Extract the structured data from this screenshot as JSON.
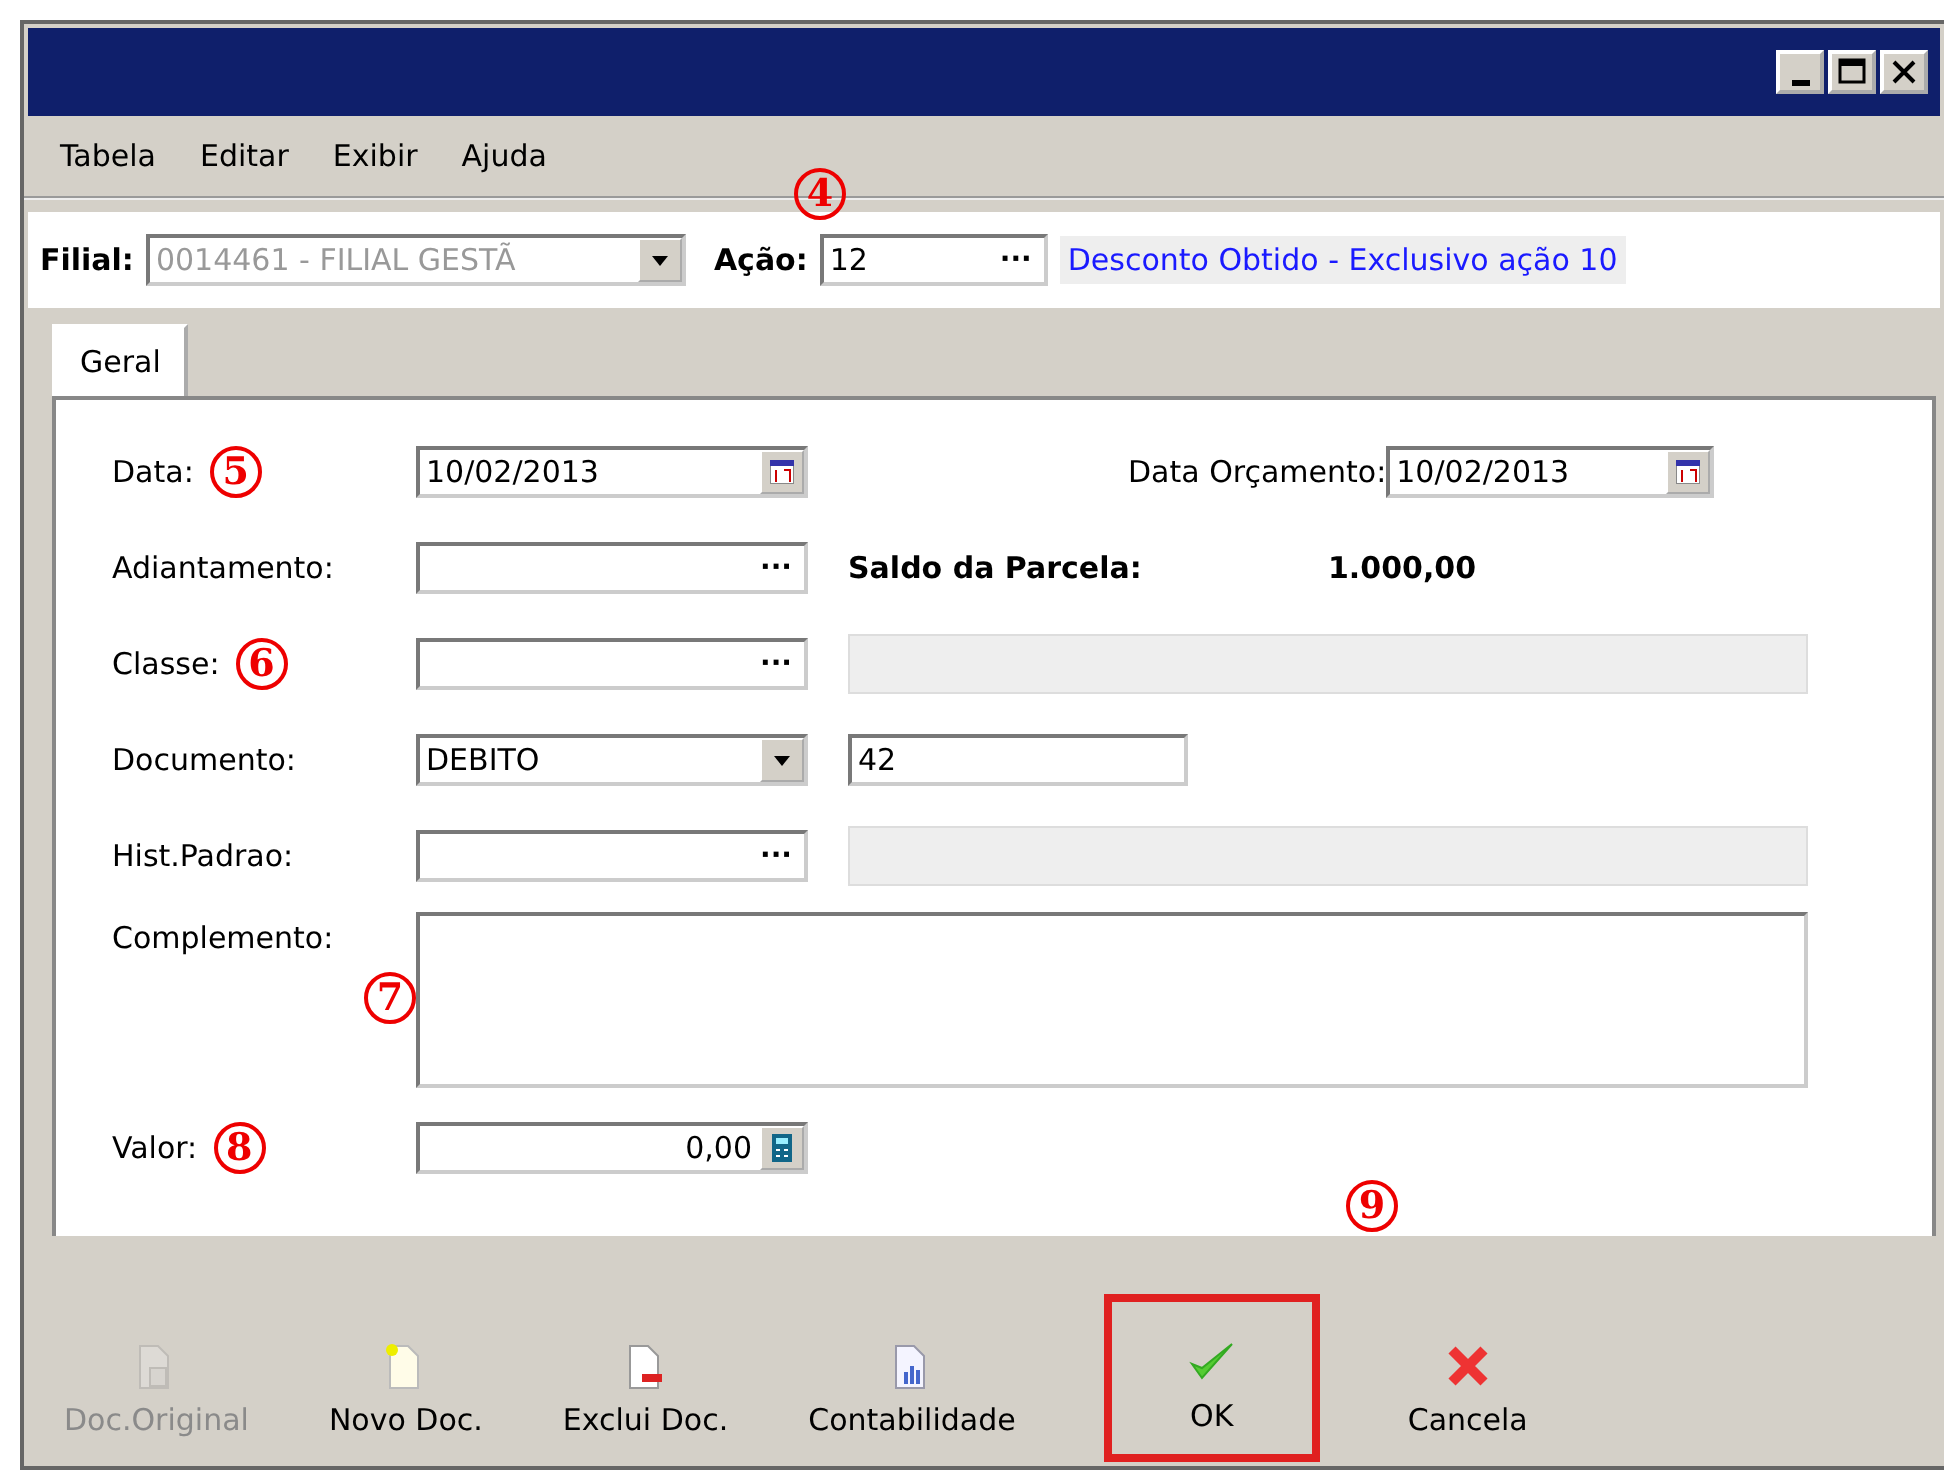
{
  "window": {
    "controls": [
      {
        "kind": "minimize"
      },
      {
        "kind": "maximize"
      },
      {
        "kind": "close"
      }
    ]
  },
  "menu": [
    {
      "label": "Tabela"
    },
    {
      "label": "Editar"
    },
    {
      "label": "Exibir"
    },
    {
      "label": "Ajuda"
    }
  ],
  "header": {
    "annotation": "4",
    "filial": {
      "label": "Filial:",
      "value": "0014461 - FILIAL GESTÃ",
      "disabled": true
    },
    "acao": {
      "label": "Ação:",
      "value": "12",
      "button": "···",
      "description": "Desconto Obtido - Exclusivo ação 10"
    }
  },
  "tabs": [
    {
      "label": "Geral",
      "selected": true
    }
  ],
  "form": {
    "data": {
      "label": "Data:",
      "value": "10/02/2013",
      "annotation": "5"
    },
    "data_orcamento": {
      "label": "Data Orçamento:",
      "value": "10/02/2013"
    },
    "adiantamento": {
      "label": "Adiantamento:",
      "button": "···"
    },
    "saldo_parcela": {
      "label": "Saldo da Parcela:",
      "value": "1.000,00"
    },
    "classe": {
      "label": "Classe:",
      "button": "···",
      "annotation": "6"
    },
    "documento": {
      "label": "Documento:",
      "value": "DEBITO",
      "number": "42"
    },
    "hist_padrao": {
      "label": "Hist.Padrao:",
      "button": "···"
    },
    "complemento": {
      "label": "Complemento:",
      "annotation": "7"
    },
    "valor": {
      "label": "Valor:",
      "value": "0,00",
      "annotation": "8"
    }
  },
  "toolbar": {
    "annotation": "9",
    "buttons": [
      {
        "kind": "doc-original",
        "label": "Doc.Original",
        "disabled": true,
        "highlighted": false
      },
      {
        "kind": "new-doc",
        "label": "Novo Doc.",
        "disabled": false,
        "highlighted": false
      },
      {
        "kind": "delete-doc",
        "label": "Exclui Doc.",
        "disabled": false,
        "highlighted": false
      },
      {
        "kind": "accounting",
        "label": "Contabilidade",
        "disabled": false,
        "highlighted": false
      },
      {
        "kind": "ok",
        "label": "OK",
        "disabled": false,
        "highlighted": true
      },
      {
        "kind": "cancel",
        "label": "Cancela",
        "disabled": false,
        "highlighted": false
      }
    ]
  }
}
